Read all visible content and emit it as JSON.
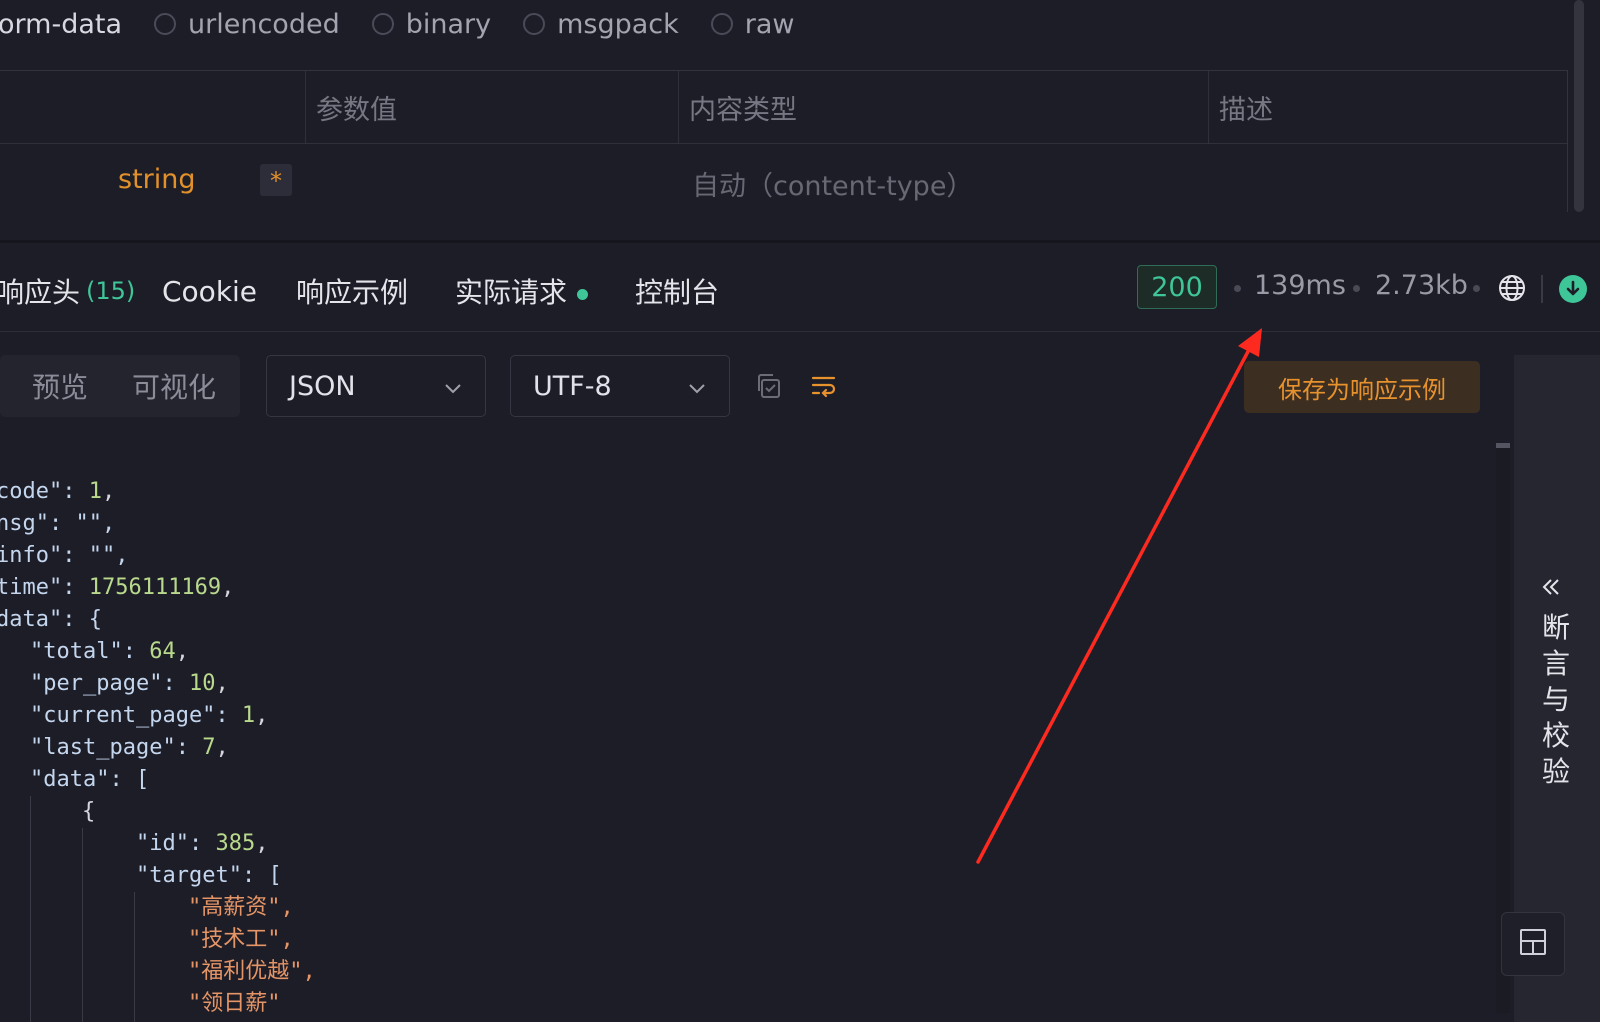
{
  "body_types": {
    "active": "orm-data",
    "options": [
      "urlencoded",
      "binary",
      "msgpack",
      "raw"
    ]
  },
  "param_table": {
    "headers": [
      "参数值",
      "内容类型",
      "描述"
    ],
    "row": {
      "type": "string",
      "required_mark": "*",
      "content_type": "自动（content-type）"
    }
  },
  "response_tabs": [
    {
      "label": "响应头",
      "count": "(15)"
    },
    {
      "label": "Cookie"
    },
    {
      "label": "响应示例"
    },
    {
      "label": "实际请求"
    },
    {
      "label": "控制台"
    }
  ],
  "response_meta": {
    "status": "200",
    "time": "139ms",
    "size": "2.73kb"
  },
  "toolbar": {
    "view_options": [
      "预览",
      "可视化"
    ],
    "format": "JSON",
    "encoding": "UTF-8",
    "save_example_label": "保存为响应示例"
  },
  "side_panel": {
    "label": "断言与校验"
  },
  "code_lines": [
    "code\": 1,",
    "nsg\": \"\",",
    "info\": \"\",",
    "time\": 1756111169,",
    "data\": {",
    "\"total\": 64,",
    "\"per_page\": 10,",
    "\"current_page\": 1,",
    "\"last_page\": 7,",
    "\"data\": [",
    "{",
    "\"id\": 385,",
    "\"target\": [",
    "\"高薪资\",",
    "\"技术工\",",
    "\"福利优越\",",
    "\"领日薪\""
  ],
  "colors": {
    "accent_green": "#3ec598",
    "accent_orange": "#e8922e",
    "annotation_red": "#ff2a1f"
  }
}
